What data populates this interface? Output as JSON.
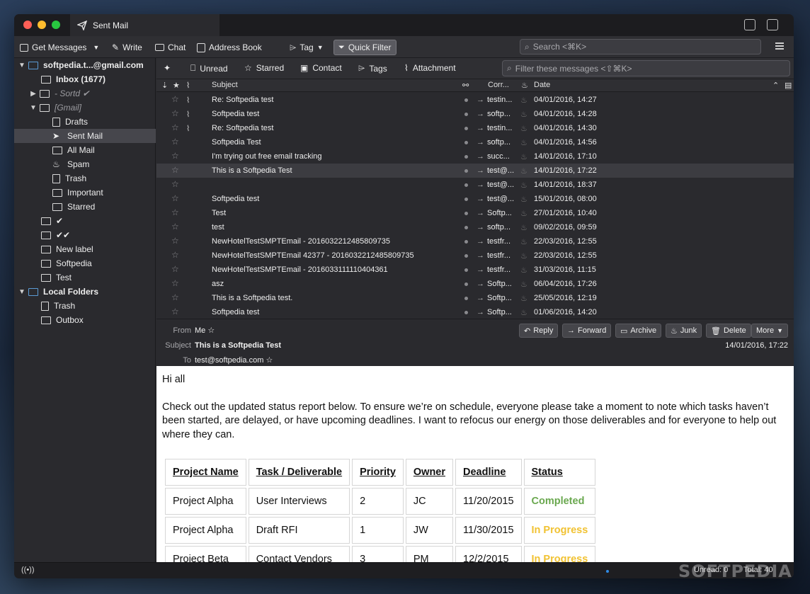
{
  "window": {
    "tab_title": "Sent Mail"
  },
  "toolbar": {
    "get_messages": "Get Messages",
    "write": "Write",
    "chat": "Chat",
    "address_book": "Address Book",
    "tag": "Tag",
    "quick_filter": "Quick Filter",
    "search_placeholder": "Search <⌘K>"
  },
  "folders": {
    "account": "softpedia.t...@gmail.com",
    "inbox": "Inbox (1677)",
    "sortd": "- Sortd ✔",
    "gmail": "[Gmail]",
    "drafts": "Drafts",
    "sent_mail": "Sent Mail",
    "all_mail": "All Mail",
    "spam": "Spam",
    "trash": "Trash",
    "important": "Important",
    "starred": "Starred",
    "check1": "✔",
    "check2": "✔✔",
    "new_label": "New label",
    "softpedia": "Softpedia",
    "test": "Test",
    "local_folders": "Local Folders",
    "local_trash": "Trash",
    "outbox": "Outbox"
  },
  "quickfilter": {
    "unread": "Unread",
    "starred": "Starred",
    "contact": "Contact",
    "tags": "Tags",
    "attachment": "Attachment",
    "filter_placeholder": "Filter these messages <⇧⌘K>"
  },
  "columns": {
    "subject": "Subject",
    "correspondent": "Corr...",
    "date": "Date"
  },
  "messages": [
    {
      "subject": "Re: Softpedia test",
      "corr": "testin...",
      "date": "04/01/2016, 14:27",
      "attach": true
    },
    {
      "subject": "Softpedia test",
      "corr": "softp...",
      "date": "04/01/2016, 14:28",
      "attach": true
    },
    {
      "subject": "Re: Softpedia test",
      "corr": "testin...",
      "date": "04/01/2016, 14:30",
      "attach": true
    },
    {
      "subject": "Softpedia Test",
      "corr": "softp...",
      "date": "04/01/2016, 14:56",
      "attach": false
    },
    {
      "subject": "I'm trying out free email tracking",
      "corr": "succ...",
      "date": "14/01/2016, 17:10",
      "attach": false
    },
    {
      "subject": "This is a Softpedia Test",
      "corr": "test@...",
      "date": "14/01/2016, 17:22",
      "attach": false
    },
    {
      "subject": "",
      "corr": "test@...",
      "date": "14/01/2016, 18:37",
      "attach": false
    },
    {
      "subject": "Softpedia test",
      "corr": "test@...",
      "date": "15/01/2016, 08:00",
      "attach": false
    },
    {
      "subject": "Test",
      "corr": "Softp...",
      "date": "27/01/2016, 10:40",
      "attach": false
    },
    {
      "subject": "test",
      "corr": "softp...",
      "date": "09/02/2016, 09:59",
      "attach": false
    },
    {
      "subject": "NewHotelTestSMPTEmail  - 2016032212485809735",
      "corr": "testfr...",
      "date": "22/03/2016, 12:55",
      "attach": false
    },
    {
      "subject": "NewHotelTestSMPTEmail 42377 - 2016032212485809735",
      "corr": "testfr...",
      "date": "22/03/2016, 12:55",
      "attach": false
    },
    {
      "subject": "NewHotelTestSMPTEmail  - 2016033111110404361",
      "corr": "testfr...",
      "date": "31/03/2016, 11:15",
      "attach": false
    },
    {
      "subject": "asz",
      "corr": "Softp...",
      "date": "06/04/2016, 17:26",
      "attach": false
    },
    {
      "subject": "This is a Softpedia test.",
      "corr": "Softp...",
      "date": "25/05/2016, 12:19",
      "attach": false
    },
    {
      "subject": "Softpedia test",
      "corr": "Softp...",
      "date": "01/06/2016, 14:20",
      "attach": false
    }
  ],
  "header": {
    "from_label": "From",
    "from_value": "Me",
    "subject_label": "Subject",
    "subject_value": "This is a Softpedia Test",
    "to_label": "To",
    "to_value": "test@softpedia.com",
    "date": "14/01/2016, 17:22",
    "reply": "Reply",
    "forward": "Forward",
    "archive": "Archive",
    "junk": "Junk",
    "delete": "Delete",
    "more": "More"
  },
  "body": {
    "greeting": "Hi all",
    "paragraph": "Check out the updated status report below. To ensure we’re on schedule, everyone please take a moment to note which tasks haven’t been started, are delayed, or have upcoming deadlines. I want to refocus our energy on those deliverables and for everyone to help out where they can.",
    "table_headers": [
      "Project Name",
      "Task / Deliverable",
      "Priority",
      "Owner",
      "Deadline",
      "Status"
    ],
    "table_rows": [
      [
        "Project Alpha",
        "User Interviews",
        "2",
        "JC",
        "11/20/2015",
        "Completed"
      ],
      [
        "Project Alpha",
        "Draft RFI",
        "1",
        "JW",
        "11/30/2015",
        "In Progress"
      ],
      [
        "Project Beta",
        "Contact Vendors",
        "3",
        "PM",
        "12/2/2015",
        "In Progress"
      ]
    ],
    "status_colors": {
      "Completed": "#6aa84f",
      "In Progress": "#f1c232"
    }
  },
  "statusbar": {
    "unread": "Unread: 0",
    "total": "Total: 40"
  },
  "watermark": "SOFTPEDIA"
}
